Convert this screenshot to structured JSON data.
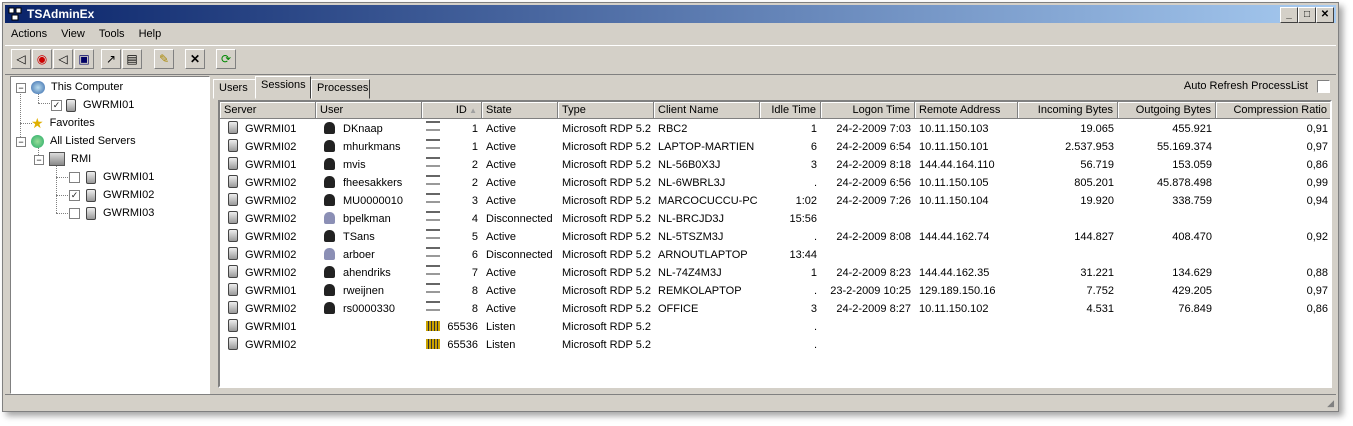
{
  "window": {
    "title": "TSAdminEx"
  },
  "menu": [
    "Actions",
    "View",
    "Tools",
    "Help"
  ],
  "toolbar": {
    "buttons": [
      "connect-icon",
      "send-message-icon",
      "reset-icon",
      "status-icon",
      "remote-control-icon",
      "properties-icon",
      "logoff-icon",
      "disconnect-x-icon",
      "refresh-icon"
    ]
  },
  "tree": {
    "this_computer": "This Computer",
    "this_computer_server": "GWRMI01",
    "favorites": "Favorites",
    "all_listed": "All Listed Servers",
    "domain": "RMI",
    "servers": [
      {
        "name": "GWRMI01",
        "checked": false
      },
      {
        "name": "GWRMI02",
        "checked": true
      },
      {
        "name": "GWRMI03",
        "checked": false
      }
    ]
  },
  "tabs": [
    "Users",
    "Sessions",
    "Processes"
  ],
  "active_tab": "Sessions",
  "auto_refresh_label": "Auto Refresh ProcessList",
  "columns": [
    "Server",
    "User",
    "ID",
    "State",
    "Type",
    "Client Name",
    "Idle Time",
    "Logon Time",
    "Remote Address",
    "Incoming Bytes",
    "Outgoing Bytes",
    "Compression Ratio"
  ],
  "sessions": [
    {
      "server": "GWRMI01",
      "user": "DKnaap",
      "id": "1",
      "state": "Active",
      "type": "Microsoft RDP 5.2",
      "client": "RBC2",
      "idle": "1",
      "logon": "24-2-2009 7:03",
      "remote": "10.11.150.103",
      "in": "19.065",
      "out": "455.921",
      "ratio": "0,91",
      "kind": "active"
    },
    {
      "server": "GWRMI02",
      "user": "mhurkmans",
      "id": "1",
      "state": "Active",
      "type": "Microsoft RDP 5.2",
      "client": "LAPTOP-MARTIEN",
      "idle": "6",
      "logon": "24-2-2009 6:54",
      "remote": "10.11.150.101",
      "in": "2.537.953",
      "out": "55.169.374",
      "ratio": "0,97",
      "kind": "active"
    },
    {
      "server": "GWRMI01",
      "user": "mvis",
      "id": "2",
      "state": "Active",
      "type": "Microsoft RDP 5.2",
      "client": "NL-56B0X3J",
      "idle": "3",
      "logon": "24-2-2009 8:18",
      "remote": "144.44.164.110",
      "in": "56.719",
      "out": "153.059",
      "ratio": "0,86",
      "kind": "active"
    },
    {
      "server": "GWRMI02",
      "user": "fheesakkers",
      "id": "2",
      "state": "Active",
      "type": "Microsoft RDP 5.2",
      "client": "NL-6WBRL3J",
      "idle": ".",
      "logon": "24-2-2009 6:56",
      "remote": "10.11.150.105",
      "in": "805.201",
      "out": "45.878.498",
      "ratio": "0,99",
      "kind": "active"
    },
    {
      "server": "GWRMI02",
      "user": "MU0000010",
      "id": "3",
      "state": "Active",
      "type": "Microsoft RDP 5.2",
      "client": "MARCOCUCCU-PC",
      "idle": "1:02",
      "logon": "24-2-2009 7:26",
      "remote": "10.11.150.104",
      "in": "19.920",
      "out": "338.759",
      "ratio": "0,94",
      "kind": "active"
    },
    {
      "server": "GWRMI02",
      "user": "bpelkman",
      "id": "4",
      "state": "Disconnected",
      "type": "Microsoft RDP 5.2",
      "client": "NL-BRCJD3J",
      "idle": "15:56",
      "logon": "",
      "remote": "",
      "in": "",
      "out": "",
      "ratio": "",
      "kind": "disc"
    },
    {
      "server": "GWRMI02",
      "user": "TSans",
      "id": "5",
      "state": "Active",
      "type": "Microsoft RDP 5.2",
      "client": "NL-5TSZM3J",
      "idle": ".",
      "logon": "24-2-2009 8:08",
      "remote": "144.44.162.74",
      "in": "144.827",
      "out": "408.470",
      "ratio": "0,92",
      "kind": "active"
    },
    {
      "server": "GWRMI02",
      "user": "arboer",
      "id": "6",
      "state": "Disconnected",
      "type": "Microsoft RDP 5.2",
      "client": "ARNOUTLAPTOP",
      "idle": "13:44",
      "logon": "",
      "remote": "",
      "in": "",
      "out": "",
      "ratio": "",
      "kind": "disc"
    },
    {
      "server": "GWRMI02",
      "user": "ahendriks",
      "id": "7",
      "state": "Active",
      "type": "Microsoft RDP 5.2",
      "client": "NL-74Z4M3J",
      "idle": "1",
      "logon": "24-2-2009 8:23",
      "remote": "144.44.162.35",
      "in": "31.221",
      "out": "134.629",
      "ratio": "0,88",
      "kind": "active"
    },
    {
      "server": "GWRMI01",
      "user": "rweijnen",
      "id": "8",
      "state": "Active",
      "type": "Microsoft RDP 5.2",
      "client": "REMKOLAPTOP",
      "idle": ".",
      "logon": "23-2-2009 10:25",
      "remote": "129.189.150.16",
      "in": "7.752",
      "out": "429.205",
      "ratio": "0,97",
      "kind": "active"
    },
    {
      "server": "GWRMI02",
      "user": "rs0000330",
      "id": "8",
      "state": "Active",
      "type": "Microsoft RDP 5.2",
      "client": "OFFICE",
      "idle": "3",
      "logon": "24-2-2009 8:27",
      "remote": "10.11.150.102",
      "in": "4.531",
      "out": "76.849",
      "ratio": "0,86",
      "kind": "active"
    },
    {
      "server": "GWRMI01",
      "user": "",
      "id": "65536",
      "state": "Listen",
      "type": "Microsoft RDP 5.2",
      "client": "",
      "idle": ".",
      "logon": "",
      "remote": "",
      "in": "",
      "out": "",
      "ratio": "",
      "kind": "listen"
    },
    {
      "server": "GWRMI02",
      "user": "",
      "id": "65536",
      "state": "Listen",
      "type": "Microsoft RDP 5.2",
      "client": "",
      "idle": ".",
      "logon": "",
      "remote": "",
      "in": "",
      "out": "",
      "ratio": "",
      "kind": "listen"
    }
  ]
}
